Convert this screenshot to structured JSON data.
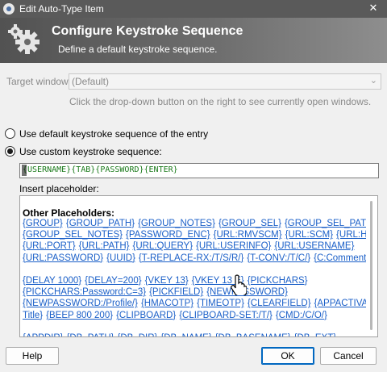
{
  "window": {
    "title": "Edit Auto-Type Item",
    "close_glyph": "✕"
  },
  "banner": {
    "title": "Configure Keystroke Sequence",
    "subtitle": "Define a default keystroke sequence.",
    "icon": "gears-icon"
  },
  "target": {
    "label": "Target window:",
    "value": "(Default)",
    "hint": "Click the drop-down button on the right to see currently open windows."
  },
  "options": {
    "default_label": "Use default keystroke sequence of the entry",
    "custom_label": "Use custom keystroke sequence:",
    "selected": "custom"
  },
  "sequence": {
    "value": "{USERNAME}{TAB}{PASSWORD}{ENTER}"
  },
  "placeholders": {
    "label": "Insert placeholder:",
    "heading": "Other Placeholders:",
    "lines": [
      [
        "{GROUP}",
        "{GROUP_PATH}",
        "{GROUP_NOTES}",
        "{GROUP_SEL}",
        "{GROUP_SEL_PATH}"
      ],
      [
        "{GROUP_SEL_NOTES}",
        "{PASSWORD_ENC}",
        "{URL:RMVSCM}",
        "{URL:SCM}",
        "{URL:HOST}"
      ],
      [
        "{URL:PORT}",
        "{URL:PATH}",
        "{URL:QUERY}",
        "{URL:USERINFO}",
        "{URL:USERNAME}"
      ],
      [
        "{URL:PASSWORD}",
        "{UUID}",
        "{T-REPLACE-RX:/T/S/R/}",
        "{T-CONV:/T/C/}",
        "{C:Comment}"
      ],
      [],
      [
        "{DELAY 1000}",
        "{DELAY=200}",
        "{VKEY 13}",
        "{VKEY 13 E}",
        "{PICKCHARS}"
      ],
      [
        "{PICKCHARS:Password:C=3}",
        "{PICKFIELD}",
        "{NEWPASSWORD}"
      ],
      [
        "{NEWPASSWORD:/Profile/}",
        "{HMACOTP}",
        "{TIMEOTP}",
        "{CLEARFIELD}",
        "{APPACTIVATE"
      ],
      [
        "Title}",
        "{BEEP 800 200}",
        "{CLIPBOARD}",
        "{CLIPBOARD-SET:/T/}",
        "{CMD:/C/O/}"
      ],
      [],
      [
        "{APPDIR}",
        "{DB_PATH}",
        "{DB_DIR}",
        "{DB_NAME}",
        "{DB_BASENAME}",
        "{DB_EXT}"
      ]
    ]
  },
  "buttons": {
    "help": "Help",
    "ok": "OK",
    "cancel": "Cancel"
  },
  "colors": {
    "link": "#1a5fc8",
    "sequence_text": "#1a7a1a",
    "banner": "#5a5a5a"
  }
}
